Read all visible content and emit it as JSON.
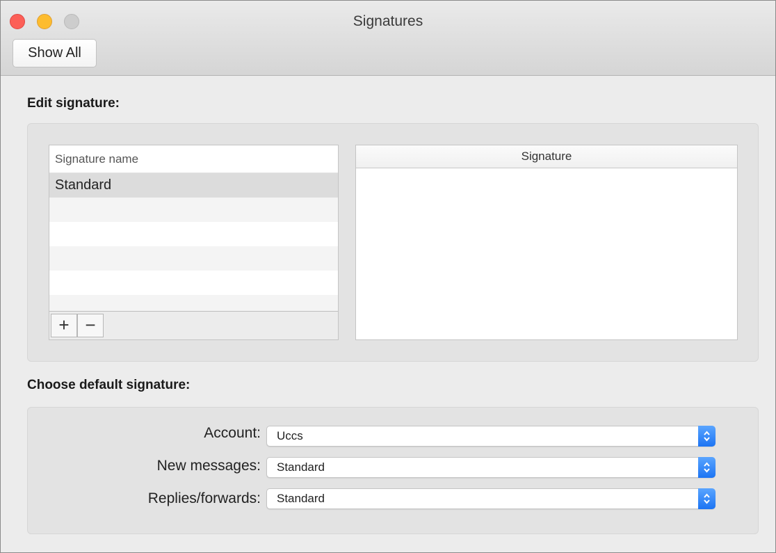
{
  "window": {
    "title": "Signatures"
  },
  "toolbar": {
    "show_all_label": "Show All"
  },
  "edit_section": {
    "title": "Edit signature:",
    "list_header": "Signature name",
    "signatures": [
      "Standard"
    ],
    "add_label": "+",
    "remove_label": "−",
    "signature_pane_header": "Signature"
  },
  "default_section": {
    "title": "Choose default signature:",
    "account_label": "Account:",
    "account_value": "Uccs",
    "new_messages_label": "New messages:",
    "new_messages_value": "Standard",
    "replies_label": "Replies/forwards:",
    "replies_value": "Standard"
  },
  "colors": {
    "accent": "#1c74f3",
    "close": "#fc5f57",
    "minimize": "#fdbc2e",
    "zoom_disabled": "#cdcdcd"
  }
}
